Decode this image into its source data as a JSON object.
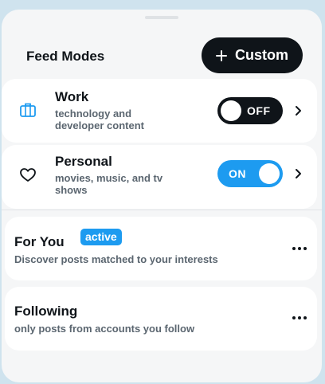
{
  "header": {
    "title": "Feed Modes",
    "custom_button": "Custom"
  },
  "modes": [
    {
      "name": "Work",
      "description": "technology and developer content",
      "toggle": "OFF",
      "icon": "briefcase-icon"
    },
    {
      "name": "Personal",
      "description": "movies, music, and tv shows",
      "toggle": "ON",
      "icon": "heart-icon"
    }
  ],
  "feeds": [
    {
      "name": "For You",
      "badge": "active",
      "description": "Discover posts matched to your interests"
    },
    {
      "name": "Following",
      "description": "only posts from accounts you follow"
    }
  ],
  "colors": {
    "accent": "#1d9bf0",
    "dark": "#0f1419",
    "muted": "#5b6670"
  }
}
